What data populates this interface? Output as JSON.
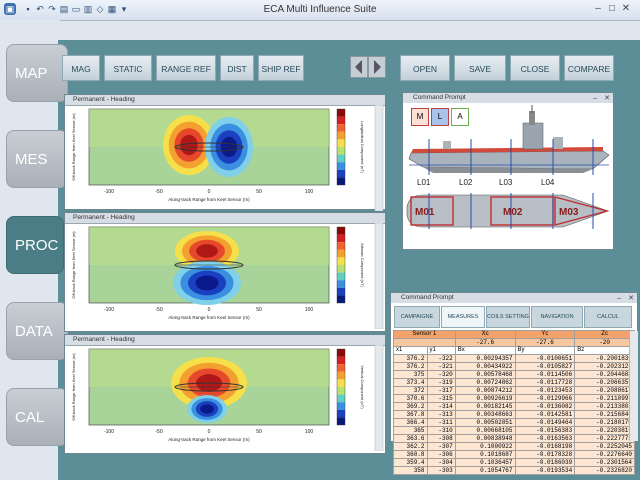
{
  "window": {
    "title": "ECA Multi Influence Suite"
  },
  "nav": [
    {
      "label": "MAP",
      "active": false
    },
    {
      "label": "MES",
      "active": false
    },
    {
      "label": "PROC",
      "active": true
    },
    {
      "label": "DATA",
      "active": false
    },
    {
      "label": "CAL",
      "active": false
    }
  ],
  "toolbar": {
    "mag": "MAG",
    "static": "STATIC",
    "range_ref": "RANGE REF",
    "dist": "DIST",
    "ship_ref": "SHIP REF",
    "open": "OPEN",
    "save": "SAVE",
    "close": "CLOSE",
    "compare": "COMPARE"
  },
  "plots": [
    {
      "title": "Permanent - Heading",
      "ylabel": "Off-track Range from Keel Sensor (m)",
      "xlabel": "Along-track Range from Keel Sensor (m)",
      "cbar_label": "Longitudinal Component (nT)",
      "xticks": [
        "-100",
        "-50",
        "0",
        "50",
        "100"
      ]
    },
    {
      "title": "Permanent - Heading",
      "ylabel": "Off-track Range from Keel Sensor (m)",
      "xlabel": "Along-track Range from Keel Sensor (m)",
      "cbar_label": "Athwart Component (nT)",
      "xticks": [
        "-100",
        "-50",
        "0",
        "50",
        "100"
      ]
    },
    {
      "title": "Permanent - Heading",
      "ylabel": "Off-track Range from Keel Sensor (m)",
      "xlabel": "Along-track Range from Keel Sensor (m)",
      "cbar_label": "Vertical Component (nT)",
      "xticks": [
        "-100",
        "-50",
        "0",
        "50",
        "100"
      ]
    }
  ],
  "ship_prompt": {
    "title": "Command Prompt",
    "buttons": [
      "M",
      "L",
      "A"
    ],
    "lines": [
      "L01",
      "L02",
      "L03",
      "L04"
    ],
    "sections": [
      "M01",
      "M02",
      "M03"
    ]
  },
  "table_prompt": {
    "title": "Command Prompt",
    "tabs": [
      "CAMPAIGNE",
      "MEASURES",
      "COILS SETTING",
      "NAVIGATION",
      "CALCUL"
    ],
    "sensor_label": "Sensor 1",
    "xc_label": "Xc",
    "yc_label": "Yc",
    "zc_label": "Zc",
    "xc_val": "-27.6",
    "yc_val": "-27.6",
    "zc_val": "-20",
    "columns": [
      "x1",
      "y1",
      "Bx",
      "By",
      "Bz"
    ],
    "rows": [
      [
        "376.2",
        "-322",
        "0.00294357",
        "-0.0100651",
        "-0.2001839"
      ],
      [
        "376.2",
        "-321",
        "0.00434922",
        "-0.0105827",
        "-0.2023123"
      ],
      [
        "375",
        "-320",
        "0.00578468",
        "-0.0114506",
        "-0.2044688"
      ],
      [
        "373.4",
        "-319",
        "0.00724862",
        "-0.0117728",
        "-0.2066359"
      ],
      [
        "372",
        "-317",
        "0.00874212",
        "-0.0123453",
        "-0.2088617"
      ],
      [
        "370.6",
        "-315",
        "0.00926619",
        "-0.0129966",
        "-0.2110997"
      ],
      [
        "369.2",
        "-314",
        "0.00182145",
        "-0.0136082",
        "-0.2133802"
      ],
      [
        "367.8",
        "-313",
        "0.00348663",
        "-0.0142581",
        "-0.2156846"
      ],
      [
        "366.4",
        "-311",
        "0.00502851",
        "-0.0149464",
        "-0.2180170"
      ],
      [
        "365",
        "-310",
        "0.00668105",
        "-0.0156383",
        "-0.2203819"
      ],
      [
        "363.6",
        "-308",
        "0.00838948",
        "-0.0163563",
        "-0.2227772"
      ],
      [
        "362.2",
        "-307",
        "0.1000922",
        "-0.0168198",
        "-0.2252045"
      ],
      [
        "360.8",
        "-306",
        "0.1018687",
        "-0.0178328",
        "-0.2276640"
      ],
      [
        "359.4",
        "-304",
        "0.1036457",
        "-0.0186039",
        "-0.2301564"
      ],
      [
        "358",
        "-303",
        "0.1054767",
        "-0.0193534",
        "-0.2326820"
      ]
    ]
  },
  "colors": {
    "main_bg": "#5b8e96",
    "accent": "#4a7d86"
  }
}
